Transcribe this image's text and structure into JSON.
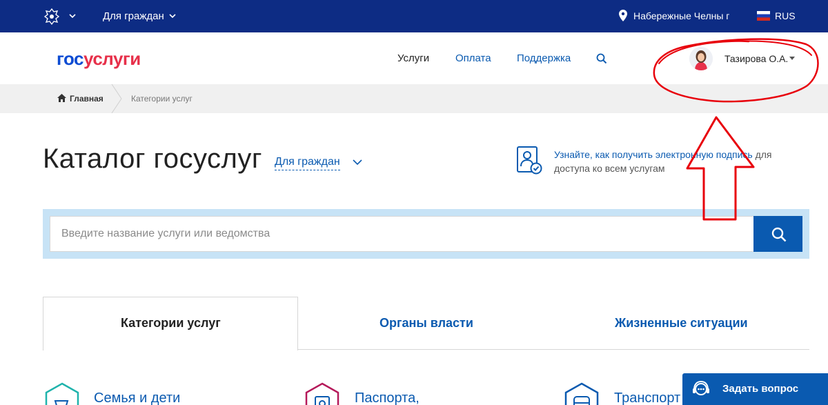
{
  "topbar": {
    "audience": "Для граждан",
    "location": "Набережные Челны г",
    "language": "RUS"
  },
  "header": {
    "logo_part1": "гос",
    "logo_part2": "услуги",
    "nav": [
      "Услуги",
      "Оплата",
      "Поддержка"
    ],
    "user_name": "Тазирова О.А."
  },
  "breadcrumb": {
    "home": "Главная",
    "current": "Категории услуг"
  },
  "catalog": {
    "title": "Каталог госуслуг",
    "audience": "Для граждан"
  },
  "signature_promo": {
    "link_text": "Узнайте, как получить электронную подпись",
    "rest_text": " для доступа ко всем услугам"
  },
  "search": {
    "placeholder": "Введите название услуги или ведомства",
    "value": ""
  },
  "tabs": [
    "Категории услуг",
    "Органы власти",
    "Жизненные ситуации"
  ],
  "categories": [
    "Семья и дети",
    "Паспорта,",
    "Транспорт"
  ],
  "ask_button": "Задать вопрос",
  "colors": {
    "topbar": "#0d2c84",
    "accent": "#0a5ab0",
    "logo_blue": "#0d4cd3",
    "logo_red": "#e7304a",
    "annotation": "#e8000b"
  }
}
